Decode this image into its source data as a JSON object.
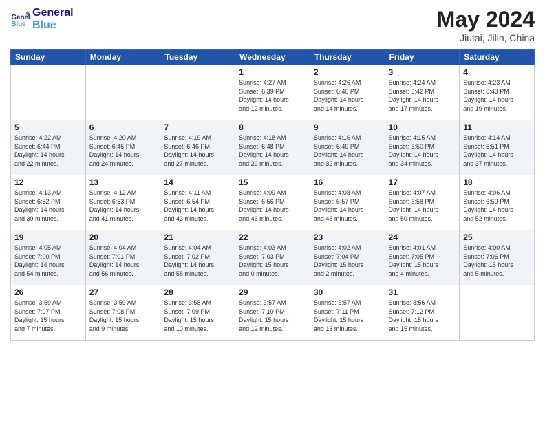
{
  "logo": {
    "line1": "General",
    "line2": "Blue"
  },
  "title": "May 2024",
  "location": "Jiutai, Jilin, China",
  "days_header": [
    "Sunday",
    "Monday",
    "Tuesday",
    "Wednesday",
    "Thursday",
    "Friday",
    "Saturday"
  ],
  "weeks": [
    [
      {
        "day": "",
        "info": ""
      },
      {
        "day": "",
        "info": ""
      },
      {
        "day": "",
        "info": ""
      },
      {
        "day": "1",
        "info": "Sunrise: 4:27 AM\nSunset: 6:39 PM\nDaylight: 14 hours\nand 12 minutes."
      },
      {
        "day": "2",
        "info": "Sunrise: 4:26 AM\nSunset: 6:40 PM\nDaylight: 14 hours\nand 14 minutes."
      },
      {
        "day": "3",
        "info": "Sunrise: 4:24 AM\nSunset: 6:42 PM\nDaylight: 14 hours\nand 17 minutes."
      },
      {
        "day": "4",
        "info": "Sunrise: 4:23 AM\nSunset: 6:43 PM\nDaylight: 14 hours\nand 19 minutes."
      }
    ],
    [
      {
        "day": "5",
        "info": "Sunrise: 4:22 AM\nSunset: 6:44 PM\nDaylight: 14 hours\nand 22 minutes."
      },
      {
        "day": "6",
        "info": "Sunrise: 4:20 AM\nSunset: 6:45 PM\nDaylight: 14 hours\nand 24 minutes."
      },
      {
        "day": "7",
        "info": "Sunrise: 4:19 AM\nSunset: 6:46 PM\nDaylight: 14 hours\nand 27 minutes."
      },
      {
        "day": "8",
        "info": "Sunrise: 4:18 AM\nSunset: 6:48 PM\nDaylight: 14 hours\nand 29 minutes."
      },
      {
        "day": "9",
        "info": "Sunrise: 4:16 AM\nSunset: 6:49 PM\nDaylight: 14 hours\nand 32 minutes."
      },
      {
        "day": "10",
        "info": "Sunrise: 4:15 AM\nSunset: 6:50 PM\nDaylight: 14 hours\nand 34 minutes."
      },
      {
        "day": "11",
        "info": "Sunrise: 4:14 AM\nSunset: 6:51 PM\nDaylight: 14 hours\nand 37 minutes."
      }
    ],
    [
      {
        "day": "12",
        "info": "Sunrise: 4:13 AM\nSunset: 6:52 PM\nDaylight: 14 hours\nand 39 minutes."
      },
      {
        "day": "13",
        "info": "Sunrise: 4:12 AM\nSunset: 6:53 PM\nDaylight: 14 hours\nand 41 minutes."
      },
      {
        "day": "14",
        "info": "Sunrise: 4:11 AM\nSunset: 6:54 PM\nDaylight: 14 hours\nand 43 minutes."
      },
      {
        "day": "15",
        "info": "Sunrise: 4:09 AM\nSunset: 6:56 PM\nDaylight: 14 hours\nand 46 minutes."
      },
      {
        "day": "16",
        "info": "Sunrise: 4:08 AM\nSunset: 6:57 PM\nDaylight: 14 hours\nand 48 minutes."
      },
      {
        "day": "17",
        "info": "Sunrise: 4:07 AM\nSunset: 6:58 PM\nDaylight: 14 hours\nand 50 minutes."
      },
      {
        "day": "18",
        "info": "Sunrise: 4:06 AM\nSunset: 6:59 PM\nDaylight: 14 hours\nand 52 minutes."
      }
    ],
    [
      {
        "day": "19",
        "info": "Sunrise: 4:05 AM\nSunset: 7:00 PM\nDaylight: 14 hours\nand 54 minutes."
      },
      {
        "day": "20",
        "info": "Sunrise: 4:04 AM\nSunset: 7:01 PM\nDaylight: 14 hours\nand 56 minutes."
      },
      {
        "day": "21",
        "info": "Sunrise: 4:04 AM\nSunset: 7:02 PM\nDaylight: 14 hours\nand 58 minutes."
      },
      {
        "day": "22",
        "info": "Sunrise: 4:03 AM\nSunset: 7:03 PM\nDaylight: 15 hours\nand 0 minutes."
      },
      {
        "day": "23",
        "info": "Sunrise: 4:02 AM\nSunset: 7:04 PM\nDaylight: 15 hours\nand 2 minutes."
      },
      {
        "day": "24",
        "info": "Sunrise: 4:01 AM\nSunset: 7:05 PM\nDaylight: 15 hours\nand 4 minutes."
      },
      {
        "day": "25",
        "info": "Sunrise: 4:00 AM\nSunset: 7:06 PM\nDaylight: 15 hours\nand 5 minutes."
      }
    ],
    [
      {
        "day": "26",
        "info": "Sunrise: 3:59 AM\nSunset: 7:07 PM\nDaylight: 15 hours\nand 7 minutes."
      },
      {
        "day": "27",
        "info": "Sunrise: 3:59 AM\nSunset: 7:08 PM\nDaylight: 15 hours\nand 9 minutes."
      },
      {
        "day": "28",
        "info": "Sunrise: 3:58 AM\nSunset: 7:09 PM\nDaylight: 15 hours\nand 10 minutes."
      },
      {
        "day": "29",
        "info": "Sunrise: 3:57 AM\nSunset: 7:10 PM\nDaylight: 15 hours\nand 12 minutes."
      },
      {
        "day": "30",
        "info": "Sunrise: 3:57 AM\nSunset: 7:11 PM\nDaylight: 15 hours\nand 13 minutes."
      },
      {
        "day": "31",
        "info": "Sunrise: 3:56 AM\nSunset: 7:12 PM\nDaylight: 15 hours\nand 15 minutes."
      },
      {
        "day": "",
        "info": ""
      }
    ]
  ]
}
